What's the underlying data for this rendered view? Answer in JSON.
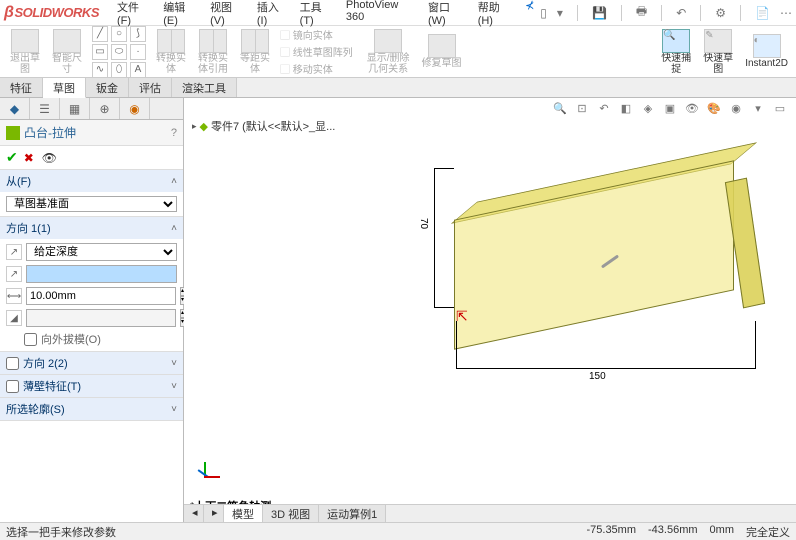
{
  "app": {
    "name": "SOLIDWORKS"
  },
  "menu": [
    "文件(F)",
    "编辑(E)",
    "视图(V)",
    "插入(I)",
    "工具(T)",
    "PhotoView 360",
    "窗口(W)",
    "帮助(H)"
  ],
  "ribbon": {
    "g1": {
      "l1": "退出草",
      "l2": "图"
    },
    "g2": {
      "l1": "智能尺",
      "l2": "寸"
    },
    "g3": {
      "l1": "转换实",
      "l2": "体"
    },
    "g4": {
      "l1": "转换实",
      "l2": "体引用"
    },
    "g5": {
      "l1": "等距实",
      "l2": "体"
    },
    "m1": "镜向实体",
    "m2": "线性草图阵列",
    "m3": "移动实体",
    "g6": {
      "l1": "显示/删除",
      "l2": "几何关系"
    },
    "g7": "修复草图",
    "g8": {
      "l1": "快速捕",
      "l2": "捉"
    },
    "g9": {
      "l1": "快速草",
      "l2": "图"
    },
    "g10": "Instant2D"
  },
  "cmd_tabs": [
    "特征",
    "草图",
    "钣金",
    "评估",
    "渲染工具"
  ],
  "pm": {
    "feature_title": "凸台-拉伸",
    "sec_from": "从(F)",
    "from_value": "草图基准面",
    "sec_dir1": "方向 1(1)",
    "dir1_type": "给定深度",
    "dir1_depth_placeholder": "",
    "dir1_distance": "10.00mm",
    "draft_label": "向外拔模(O)",
    "sec_dir2": "方向 2(2)",
    "sec_thin": "薄壁特征(T)",
    "sec_contours": "所选轮廓(S)"
  },
  "breadcrumb": {
    "part": "零件7",
    "state": "(默认<<默认>_显..."
  },
  "dims": {
    "w": "150",
    "h": "70"
  },
  "view_label": "*上下二等角轴测",
  "bottom_tabs": [
    "模型",
    "3D 视图",
    "运动算例1"
  ],
  "status": {
    "msg": "选择一把手来修改参数",
    "x": "-75.35mm",
    "y": "-43.56mm",
    "z": "0mm",
    "fit": "完全定义"
  }
}
